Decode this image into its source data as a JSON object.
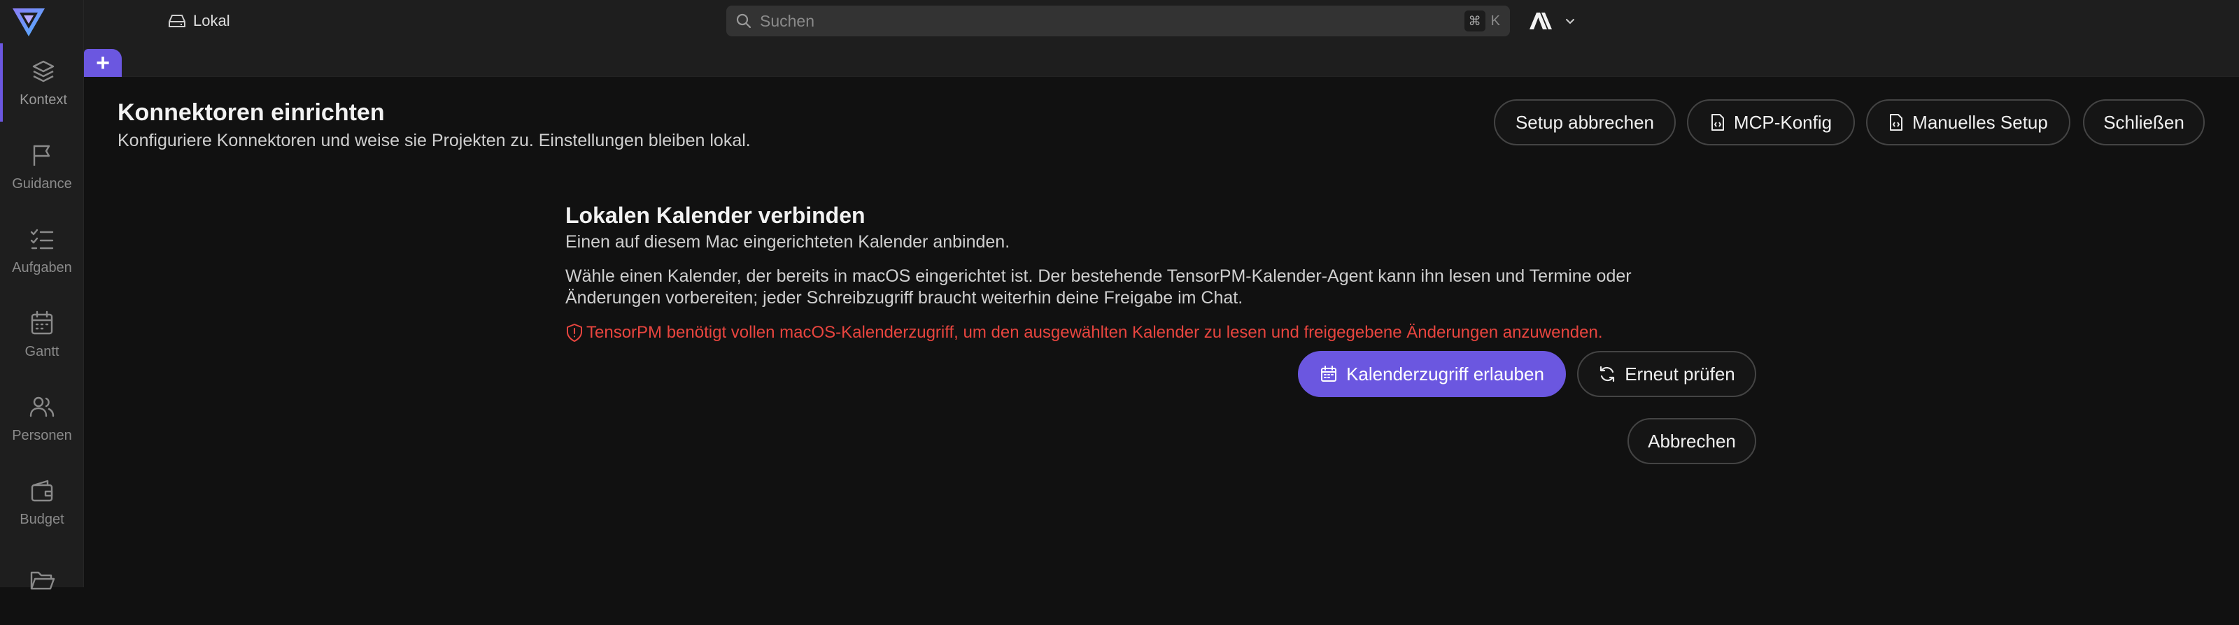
{
  "sidebar": {
    "items": [
      {
        "label": "Kontext",
        "icon": "layers-icon"
      },
      {
        "label": "Guidance",
        "icon": "flag-icon"
      },
      {
        "label": "Aufgaben",
        "icon": "checklist-icon"
      },
      {
        "label": "Gantt",
        "icon": "calendar-icon"
      },
      {
        "label": "Personen",
        "icon": "people-icon"
      },
      {
        "label": "Budget",
        "icon": "wallet-icon"
      },
      {
        "label": "",
        "icon": "folder-icon"
      }
    ],
    "active_item": "Kontext"
  },
  "topbar": {
    "workspace_label": "Lokal",
    "search_placeholder": "Suchen",
    "shortcut_modifier": "⌘",
    "shortcut_key": "K"
  },
  "tabs": {
    "add_label": "+"
  },
  "header": {
    "title": "Konnektoren einrichten",
    "subtitle": "Konfiguriere Konnektoren und weise sie Projekten zu. Einstellungen bleiben lokal.",
    "buttons": {
      "cancel_setup": "Setup abbrechen",
      "mcp_config": "MCP-Konfig",
      "manual_setup": "Manuelles Setup",
      "close": "Schließen"
    }
  },
  "calendar_section": {
    "title": "Lokalen Kalender verbinden",
    "subtitle": "Einen auf diesem Mac eingerichteten Kalender anbinden.",
    "description_line1": "Wähle einen Kalender, der bereits in macOS eingerichtet ist. Der bestehende TensorPM-Kalender-Agent kann ihn lesen und Termine oder",
    "description_line2": "Änderungen vorbereiten; jeder Schreibzugriff braucht weiterhin deine Freigabe im Chat.",
    "warning": "TensorPM benötigt vollen macOS-Kalenderzugriff, um den ausgewählten Kalender zu lesen und freigegebene Änderungen anzuwenden.",
    "allow_button": "Kalenderzugriff erlauben",
    "retry_button": "Erneut prüfen",
    "cancel_button": "Abbrechen"
  },
  "colors": {
    "accent": "#6b57e0",
    "warning": "#e8453f",
    "background": "#111111",
    "sidebar": "#1e1e1e"
  }
}
